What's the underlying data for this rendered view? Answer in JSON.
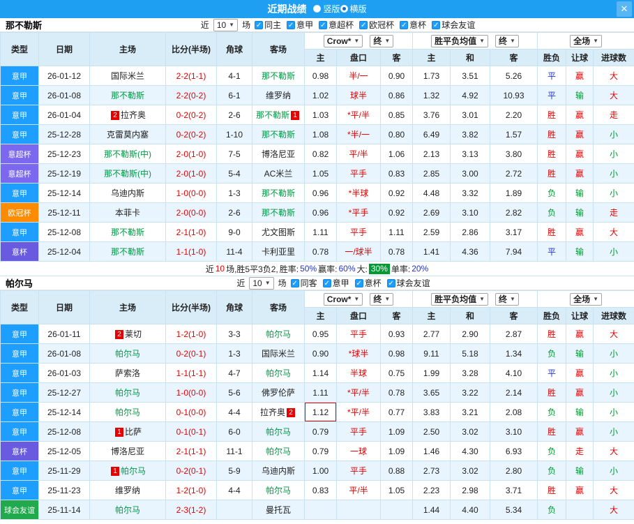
{
  "titlebar": {
    "title": "近期战绩",
    "close": "✕",
    "layout_options": [
      {
        "label": "竖版",
        "selected": false
      },
      {
        "label": "横版",
        "selected": true
      }
    ]
  },
  "filters": {
    "near": "近",
    "games": "10",
    "games_suffix": "场",
    "bookmaker": "Crow*",
    "final": "终",
    "wdl_average": "胜平负均值",
    "scope": "全场"
  },
  "columns": {
    "type": "类型",
    "date": "日期",
    "home": "主场",
    "score": "比分(半场)",
    "corner": "角球",
    "away": "客场",
    "asia_home": "主",
    "handicap": "盘口",
    "asia_away": "客",
    "eu_home": "主",
    "eu_draw": "和",
    "eu_away": "客",
    "result": "胜负",
    "let_goal": "让球",
    "goals": "进球数"
  },
  "type_colors": {
    "意甲": "#1E9FFF",
    "意超杯": "#7B68EE",
    "欧冠杯": "#FF8C00",
    "意杯": "#6A5AE0",
    "球会友谊": "#21A94D"
  },
  "result_colors": {
    "r": "#E60000",
    "g": "#009933",
    "b": "#2233CC"
  },
  "sections": [
    {
      "team": "那不勒斯",
      "checkboxes": [
        {
          "label": "同主",
          "checked": true
        },
        {
          "label": "意甲",
          "checked": true
        },
        {
          "label": "意超杯",
          "checked": true
        },
        {
          "label": "欧冠杯",
          "checked": true
        },
        {
          "label": "意杯",
          "checked": true
        },
        {
          "label": "球会友谊",
          "checked": true
        }
      ],
      "rows": [
        {
          "type": "意甲",
          "date": "26-01-12",
          "home": {
            "name": "国际米兰"
          },
          "score": "2-2(1-1)",
          "corner": "4-1",
          "away": {
            "name": "那不勒斯",
            "green": true
          },
          "asia": [
            "0.98",
            "半/一",
            "0.90"
          ],
          "europe": [
            "1.73",
            "3.51",
            "5.26"
          ],
          "res": [
            "平",
            "b"
          ],
          "let": [
            "赢",
            "r"
          ],
          "goal": [
            "大",
            "r"
          ]
        },
        {
          "type": "意甲",
          "date": "26-01-08",
          "home": {
            "name": "那不勒斯",
            "green": true
          },
          "score": "2-2(0-2)",
          "corner": "6-1",
          "away": {
            "name": "维罗纳"
          },
          "asia": [
            "1.02",
            "球半",
            "0.86"
          ],
          "europe": [
            "1.32",
            "4.92",
            "10.93"
          ],
          "res": [
            "平",
            "b"
          ],
          "let": [
            "输",
            "g"
          ],
          "goal": [
            "大",
            "r"
          ]
        },
        {
          "type": "意甲",
          "date": "26-01-04",
          "home": {
            "name": "拉齐奥",
            "badge": "2"
          },
          "score": "0-2(0-2)",
          "corner": "2-6",
          "away": {
            "name": "那不勒斯",
            "green": true,
            "badge": "1"
          },
          "asia": [
            "1.03",
            "*平/半",
            "0.85"
          ],
          "europe": [
            "3.76",
            "3.01",
            "2.20"
          ],
          "res": [
            "胜",
            "r"
          ],
          "let": [
            "赢",
            "r"
          ],
          "goal": [
            "走",
            "r"
          ]
        },
        {
          "type": "意甲",
          "date": "25-12-28",
          "home": {
            "name": "克雷莫内塞"
          },
          "score": "0-2(0-2)",
          "corner": "1-10",
          "away": {
            "name": "那不勒斯",
            "green": true
          },
          "asia": [
            "1.08",
            "*半/一",
            "0.80"
          ],
          "europe": [
            "6.49",
            "3.82",
            "1.57"
          ],
          "res": [
            "胜",
            "r"
          ],
          "let": [
            "赢",
            "r"
          ],
          "goal": [
            "小",
            "g"
          ]
        },
        {
          "type": "意超杯",
          "date": "25-12-23",
          "home": {
            "name": "那不勒斯(中)",
            "green": true
          },
          "score": "2-0(1-0)",
          "corner": "7-5",
          "away": {
            "name": "博洛尼亚"
          },
          "asia": [
            "0.82",
            "平/半",
            "1.06"
          ],
          "europe": [
            "2.13",
            "3.13",
            "3.80"
          ],
          "res": [
            "胜",
            "r"
          ],
          "let": [
            "赢",
            "r"
          ],
          "goal": [
            "小",
            "g"
          ]
        },
        {
          "type": "意超杯",
          "date": "25-12-19",
          "home": {
            "name": "那不勒斯(中)",
            "green": true
          },
          "score": "2-0(1-0)",
          "corner": "5-4",
          "away": {
            "name": "AC米兰"
          },
          "asia": [
            "1.05",
            "平手",
            "0.83"
          ],
          "europe": [
            "2.85",
            "3.00",
            "2.72"
          ],
          "res": [
            "胜",
            "r"
          ],
          "let": [
            "赢",
            "r"
          ],
          "goal": [
            "小",
            "g"
          ]
        },
        {
          "type": "意甲",
          "date": "25-12-14",
          "home": {
            "name": "乌迪内斯"
          },
          "score": "1-0(0-0)",
          "corner": "1-3",
          "away": {
            "name": "那不勒斯",
            "green": true
          },
          "asia": [
            "0.96",
            "*半球",
            "0.92"
          ],
          "europe": [
            "4.48",
            "3.32",
            "1.89"
          ],
          "res": [
            "负",
            "g"
          ],
          "let": [
            "输",
            "g"
          ],
          "goal": [
            "小",
            "g"
          ]
        },
        {
          "type": "欧冠杯",
          "date": "25-12-11",
          "home": {
            "name": "本菲卡"
          },
          "score": "2-0(0-0)",
          "corner": "2-6",
          "away": {
            "name": "那不勒斯",
            "green": true
          },
          "asia": [
            "0.96",
            "*平手",
            "0.92"
          ],
          "europe": [
            "2.69",
            "3.10",
            "2.82"
          ],
          "res": [
            "负",
            "g"
          ],
          "let": [
            "输",
            "g"
          ],
          "goal": [
            "走",
            "r"
          ]
        },
        {
          "type": "意甲",
          "date": "25-12-08",
          "home": {
            "name": "那不勒斯",
            "green": true
          },
          "score": "2-1(1-0)",
          "corner": "9-0",
          "away": {
            "name": "尤文图斯"
          },
          "asia": [
            "1.11",
            "平手",
            "1.11"
          ],
          "europe": [
            "2.59",
            "2.86",
            "3.17"
          ],
          "res": [
            "胜",
            "r"
          ],
          "let": [
            "赢",
            "r"
          ],
          "goal": [
            "大",
            "r"
          ]
        },
        {
          "type": "意杯",
          "date": "25-12-04",
          "home": {
            "name": "那不勒斯",
            "green": true
          },
          "score": "1-1(1-0)",
          "corner": "11-4",
          "away": {
            "name": "卡利亚里"
          },
          "asia": [
            "0.78",
            "一/球半",
            "0.78"
          ],
          "europe": [
            "1.41",
            "4.36",
            "7.94"
          ],
          "res": [
            "平",
            "b"
          ],
          "let": [
            "输",
            "g"
          ],
          "goal": [
            "小",
            "g"
          ]
        }
      ],
      "summary": [
        {
          "t": "近"
        },
        {
          "t": "10",
          "c": "#E60000"
        },
        {
          "t": "场,胜5平3负2, "
        },
        {
          "t": "胜率:"
        },
        {
          "t": "50%",
          "c": "#2233CC"
        },
        {
          "t": " 赢率:"
        },
        {
          "t": "60%",
          "c": "#2233CC"
        },
        {
          "t": " 大: "
        },
        {
          "t": "30%",
          "c": "#FFFFFF",
          "bg": "#009933"
        },
        {
          "t": " 单率:"
        },
        {
          "t": "20%",
          "c": "#2233CC"
        }
      ]
    },
    {
      "team": "帕尔马",
      "checkboxes": [
        {
          "label": "同客",
          "checked": true
        },
        {
          "label": "意甲",
          "checked": true
        },
        {
          "label": "意杯",
          "checked": true
        },
        {
          "label": "球会友谊",
          "checked": true
        }
      ],
      "rows": [
        {
          "type": "意甲",
          "date": "26-01-11",
          "home": {
            "name": "莱切",
            "badge": "2"
          },
          "score": "1-2(1-0)",
          "corner": "3-3",
          "away": {
            "name": "帕尔马",
            "green": true
          },
          "asia": [
            "0.95",
            "平手",
            "0.93"
          ],
          "europe": [
            "2.77",
            "2.90",
            "2.87"
          ],
          "res": [
            "胜",
            "r"
          ],
          "let": [
            "赢",
            "r"
          ],
          "goal": [
            "大",
            "r"
          ]
        },
        {
          "type": "意甲",
          "date": "26-01-08",
          "home": {
            "name": "帕尔马",
            "green": true
          },
          "score": "0-2(0-1)",
          "corner": "1-3",
          "away": {
            "name": "国际米兰"
          },
          "asia": [
            "0.90",
            "*球半",
            "0.98"
          ],
          "europe": [
            "9.11",
            "5.18",
            "1.34"
          ],
          "res": [
            "负",
            "g"
          ],
          "let": [
            "输",
            "g"
          ],
          "goal": [
            "小",
            "g"
          ]
        },
        {
          "type": "意甲",
          "date": "26-01-03",
          "home": {
            "name": "萨索洛"
          },
          "score": "1-1(1-1)",
          "corner": "4-7",
          "away": {
            "name": "帕尔马",
            "green": true
          },
          "asia": [
            "1.14",
            "半球",
            "0.75"
          ],
          "europe": [
            "1.99",
            "3.28",
            "4.10"
          ],
          "res": [
            "平",
            "b"
          ],
          "let": [
            "赢",
            "r"
          ],
          "goal": [
            "小",
            "g"
          ]
        },
        {
          "type": "意甲",
          "date": "25-12-27",
          "home": {
            "name": "帕尔马",
            "green": true
          },
          "score": "1-0(0-0)",
          "corner": "5-6",
          "away": {
            "name": "佛罗伦萨"
          },
          "asia": [
            "1.11",
            "*平/半",
            "0.78"
          ],
          "europe": [
            "3.65",
            "3.22",
            "2.14"
          ],
          "res": [
            "胜",
            "r"
          ],
          "let": [
            "赢",
            "r"
          ],
          "goal": [
            "小",
            "g"
          ]
        },
        {
          "type": "意甲",
          "date": "25-12-14",
          "home": {
            "name": "帕尔马",
            "green": true
          },
          "score": "0-1(0-0)",
          "corner": "4-4",
          "away": {
            "name": "拉齐奥",
            "badge": "2"
          },
          "asia": [
            "1.12",
            "*平/半",
            "0.77"
          ],
          "asia_hl": 0,
          "europe": [
            "3.83",
            "3.21",
            "2.08"
          ],
          "res": [
            "负",
            "g"
          ],
          "let": [
            "输",
            "g"
          ],
          "goal": [
            "小",
            "g"
          ]
        },
        {
          "type": "意甲",
          "date": "25-12-08",
          "home": {
            "name": "比萨",
            "badge": "1"
          },
          "score": "0-1(0-1)",
          "corner": "6-0",
          "away": {
            "name": "帕尔马",
            "green": true
          },
          "asia": [
            "0.79",
            "平手",
            "1.09"
          ],
          "europe": [
            "2.50",
            "3.02",
            "3.10"
          ],
          "res": [
            "胜",
            "r"
          ],
          "let": [
            "赢",
            "r"
          ],
          "goal": [
            "小",
            "g"
          ]
        },
        {
          "type": "意杯",
          "date": "25-12-05",
          "home": {
            "name": "博洛尼亚"
          },
          "score": "2-1(1-1)",
          "corner": "11-1",
          "away": {
            "name": "帕尔马",
            "green": true
          },
          "asia": [
            "0.79",
            "一球",
            "1.09"
          ],
          "europe": [
            "1.46",
            "4.30",
            "6.93"
          ],
          "res": [
            "负",
            "g"
          ],
          "let": [
            "走",
            "r"
          ],
          "goal": [
            "大",
            "r"
          ]
        },
        {
          "type": "意甲",
          "date": "25-11-29",
          "home": {
            "name": "帕尔马",
            "green": true,
            "badge": "1"
          },
          "score": "0-2(0-1)",
          "corner": "5-9",
          "away": {
            "name": "乌迪内斯"
          },
          "asia": [
            "1.00",
            "平手",
            "0.88"
          ],
          "europe": [
            "2.73",
            "3.02",
            "2.80"
          ],
          "res": [
            "负",
            "g"
          ],
          "let": [
            "输",
            "g"
          ],
          "goal": [
            "小",
            "g"
          ]
        },
        {
          "type": "意甲",
          "date": "25-11-23",
          "home": {
            "name": "维罗纳"
          },
          "score": "1-2(1-0)",
          "corner": "4-4",
          "away": {
            "name": "帕尔马",
            "green": true
          },
          "asia": [
            "0.83",
            "平/半",
            "1.05"
          ],
          "europe": [
            "2.23",
            "2.98",
            "3.71"
          ],
          "res": [
            "胜",
            "r"
          ],
          "let": [
            "赢",
            "r"
          ],
          "goal": [
            "大",
            "r"
          ]
        },
        {
          "type": "球会友谊",
          "date": "25-11-14",
          "home": {
            "name": "帕尔马",
            "green": true
          },
          "score": "2-3(1-2)",
          "corner": "",
          "away": {
            "name": "曼托瓦"
          },
          "asia": [
            "",
            "",
            ""
          ],
          "europe": [
            "1.44",
            "4.40",
            "5.34"
          ],
          "res": [
            "负",
            "g"
          ],
          "let": [
            "",
            ""
          ],
          "goal": [
            "大",
            "r"
          ]
        }
      ]
    }
  ]
}
